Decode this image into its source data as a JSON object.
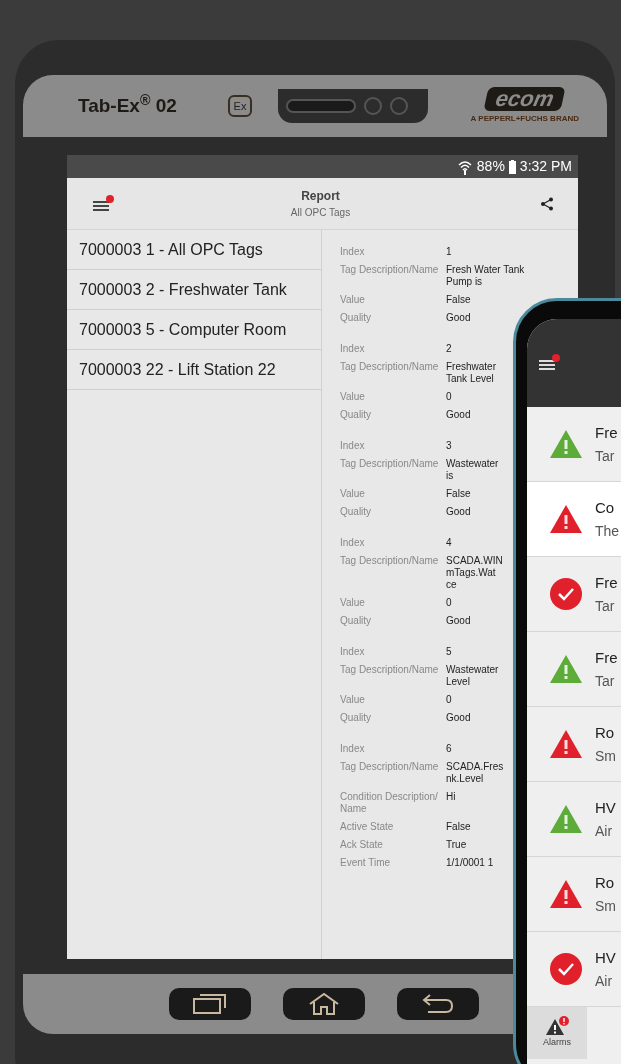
{
  "device": {
    "model": "Tab-Ex$^{®}$ 02",
    "cert_mark": "Ex",
    "brand": "ecom",
    "brand_tagline": "A PEPPERL+FUCHS BRAND"
  },
  "status_bar": {
    "battery": "88%",
    "time": "3:32 PM"
  },
  "app_bar": {
    "title": "Report",
    "subtitle": "All OPC Tags",
    "menu_badge": true
  },
  "reports": [
    {
      "label": "7000003 1 - All OPC Tags"
    },
    {
      "label": "7000003 2 - Freshwater Tank"
    },
    {
      "label": "7000003 5 - Computer Room"
    },
    {
      "label": "7000003 22 - Lift Station 22"
    }
  ],
  "tags": [
    {
      "fields": [
        {
          "label": "Index",
          "value": "1"
        },
        {
          "label": "Tag Description/Name",
          "value": "Fresh Water Tank\nPump is"
        },
        {
          "label": "Value",
          "value": "False"
        },
        {
          "label": "Quality",
          "value": "Good"
        }
      ]
    },
    {
      "fields": [
        {
          "label": "Index",
          "value": "2"
        },
        {
          "label": "Tag Description/Name",
          "value": "Freshwater\nTank Level"
        },
        {
          "label": "Value",
          "value": "0"
        },
        {
          "label": "Quality",
          "value": "Good"
        }
      ]
    },
    {
      "fields": [
        {
          "label": "Index",
          "value": "3"
        },
        {
          "label": "Tag Description/Name",
          "value": "Wastewater\nis"
        },
        {
          "label": "Value",
          "value": "False"
        },
        {
          "label": "Quality",
          "value": "Good"
        }
      ]
    },
    {
      "fields": [
        {
          "label": "Index",
          "value": "4"
        },
        {
          "label": "Tag Description/Name",
          "value": "SCADA.WIN\nmTags.Wat\nce"
        },
        {
          "label": "Value",
          "value": "0"
        },
        {
          "label": "Quality",
          "value": "Good"
        }
      ]
    },
    {
      "fields": [
        {
          "label": "Index",
          "value": "5"
        },
        {
          "label": "Tag Description/Name",
          "value": "Wastewater\nLevel"
        },
        {
          "label": "Value",
          "value": "0"
        },
        {
          "label": "Quality",
          "value": "Good"
        }
      ]
    },
    {
      "fields": [
        {
          "label": "Index",
          "value": "6"
        },
        {
          "label": "Tag Description/Name",
          "value": "SCADA.Fres\nnk.Level"
        },
        {
          "label": "Condition Description/\nName",
          "value": "Hi"
        },
        {
          "label": "Active State",
          "value": "False"
        },
        {
          "label": "Ack State",
          "value": "True"
        },
        {
          "label": "Event Time",
          "value": "1/1/0001 1"
        }
      ]
    }
  ],
  "phone": {
    "menu_badge": true,
    "alarms": [
      {
        "kind": "active",
        "color": "#5dab38",
        "title": "Fre",
        "subtitle": "Tar",
        "selected": false
      },
      {
        "kind": "active",
        "color": "#e0202a",
        "title": "Co",
        "subtitle": "The",
        "selected": true
      },
      {
        "kind": "acknowledged",
        "color": "#e0202a",
        "title": "Fre",
        "subtitle": "Tar",
        "selected": false
      },
      {
        "kind": "active",
        "color": "#5dab38",
        "title": "Fre",
        "subtitle": "Tar",
        "selected": false
      },
      {
        "kind": "active",
        "color": "#e0202a",
        "title": "Ro",
        "subtitle": "Sm",
        "selected": false
      },
      {
        "kind": "active",
        "color": "#5dab38",
        "title": "HV",
        "subtitle": "Air",
        "selected": false
      },
      {
        "kind": "active",
        "color": "#e0202a",
        "title": "Ro",
        "subtitle": "Sm",
        "selected": false
      },
      {
        "kind": "acknowledged",
        "color": "#e0202a",
        "title": "HV",
        "subtitle": "Air",
        "selected": false
      }
    ],
    "nav": [
      {
        "label": "Alarms",
        "badge": true
      }
    ]
  }
}
